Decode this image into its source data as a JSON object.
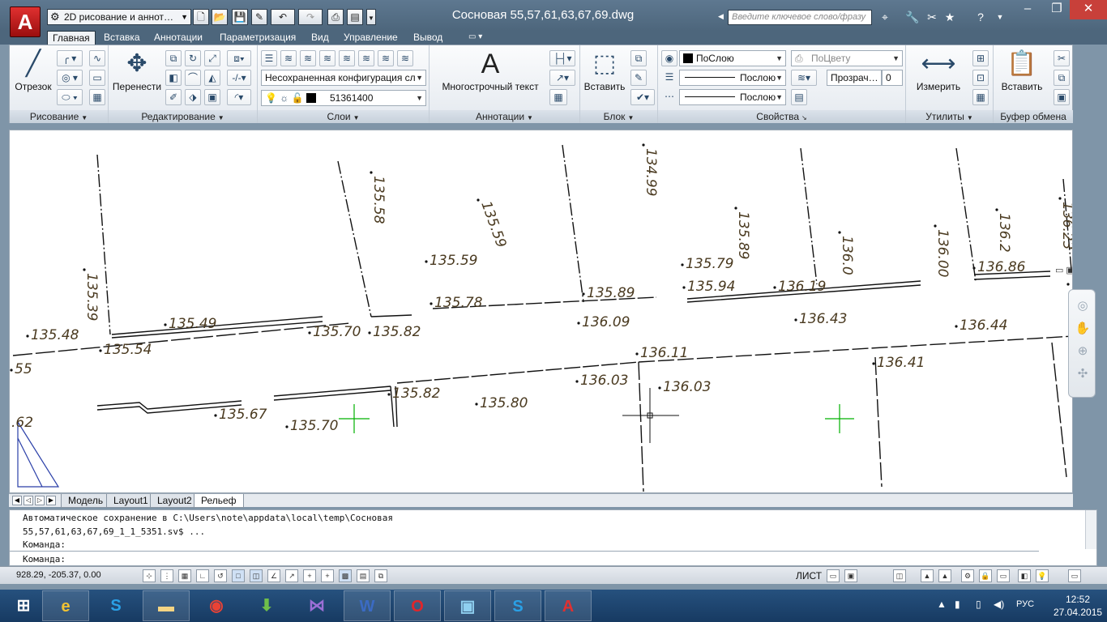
{
  "app": {
    "logo_letter": "A",
    "workspace": "2D рисование и аннот…",
    "document_title": "Сосновая 55,57,61,63,67,69.dwg",
    "search_placeholder": "Введите ключевое слово/фразу"
  },
  "ribbon_tabs": [
    "Главная",
    "Вставка",
    "Аннотации",
    "Параметризация",
    "Вид",
    "Управление",
    "Вывод"
  ],
  "ribbon": {
    "draw": {
      "title": "Рисование",
      "line_label": "Отрезок"
    },
    "modify": {
      "title": "Редактирование",
      "move_label": "Перенести"
    },
    "layers": {
      "title": "Слои",
      "config": "Несохраненная конфигурация сл",
      "current": "51361400"
    },
    "annotation": {
      "title": "Аннотации",
      "mtext_label": "Многострочный текст",
      "mtext_glyph": "A"
    },
    "block": {
      "title": "Блок",
      "insert_label": "Вставить"
    },
    "properties": {
      "title": "Свойства",
      "color": "ПоСлою",
      "plot": "ПоЦвету",
      "linetype": "Послою",
      "lineweight": "Послою",
      "transparency_label": "Прозрач…",
      "transparency_value": "0"
    },
    "utilities": {
      "title": "Утилиты",
      "measure_label": "Измерить"
    },
    "clipboard": {
      "title": "Буфер обмена",
      "paste_label": "Вставить"
    }
  },
  "drawing": {
    "elevation_labels": [
      {
        "text": "135.58",
        "rot": 90
      },
      {
        "text": "134.99",
        "rot": 90
      },
      {
        "text": "135.59",
        "rot": 70
      },
      {
        "text": "135.89",
        "rot": 90
      },
      {
        "text": "136.0",
        "rot": 90
      },
      {
        "text": "136.00",
        "rot": 90
      },
      {
        "text": "136.2",
        "rot": 90
      },
      {
        "text": "136.23",
        "rot": 90
      },
      {
        "text": "135.39",
        "rot": 90
      },
      {
        "text": "135.59",
        "rot": 0
      },
      {
        "text": "135.79",
        "rot": 0
      },
      {
        "text": "136.86",
        "rot": 0
      },
      {
        "text": "136.",
        "rot": 0
      },
      {
        "text": "135.78",
        "rot": 0
      },
      {
        "text": "135.89",
        "rot": 0
      },
      {
        "text": "135.94",
        "rot": 0
      },
      {
        "text": "136.19",
        "rot": 0
      },
      {
        "text": "135.49",
        "rot": 0
      },
      {
        "text": "135.48",
        "rot": 0
      },
      {
        "text": "135.54",
        "rot": 0
      },
      {
        "text": "135.70",
        "rot": 0
      },
      {
        "text": "135.82",
        "rot": 0
      },
      {
        "text": "136.09",
        "rot": 0
      },
      {
        "text": "136.43",
        "rot": 0
      },
      {
        "text": "136.44",
        "rot": 0
      },
      {
        "text": "136.11",
        "rot": 0
      },
      {
        "text": "136.41",
        "rot": 0
      },
      {
        "text": "55",
        "rot": 0
      },
      {
        "text": "136.03",
        "rot": 0
      },
      {
        "text": "136.03",
        "rot": 0
      },
      {
        "text": "135.82",
        "rot": 0
      },
      {
        "text": "135.80",
        "rot": 0
      },
      {
        "text": "135.67",
        "rot": 0
      },
      {
        "text": "135.70",
        "rot": 0
      },
      {
        "text": ".62",
        "rot": 0
      }
    ]
  },
  "layout_tabs": [
    "Модель",
    "Layout1",
    "Layout2",
    "Рельеф"
  ],
  "command_line": {
    "history_1": "Автоматическое сохранение в C:\\Users\\note\\appdata\\local\\temp\\Сосновая",
    "history_2": "55,57,61,63,67,69_1_1_5351.sv$ ...",
    "history_3": "Команда:",
    "prompt": "Команда:"
  },
  "status_bar": {
    "coords": "928.29, -205.37, 0.00",
    "layout_label": "ЛИСТ"
  },
  "taskbar": {
    "lang": "РУС",
    "time": "12:52",
    "date": "27.04.2015"
  },
  "colors": {
    "titlebar": "#4d667c",
    "drawing_text": "#4a3a20",
    "crosshair_green": "#00b000",
    "taskbar": "#1f4670"
  }
}
